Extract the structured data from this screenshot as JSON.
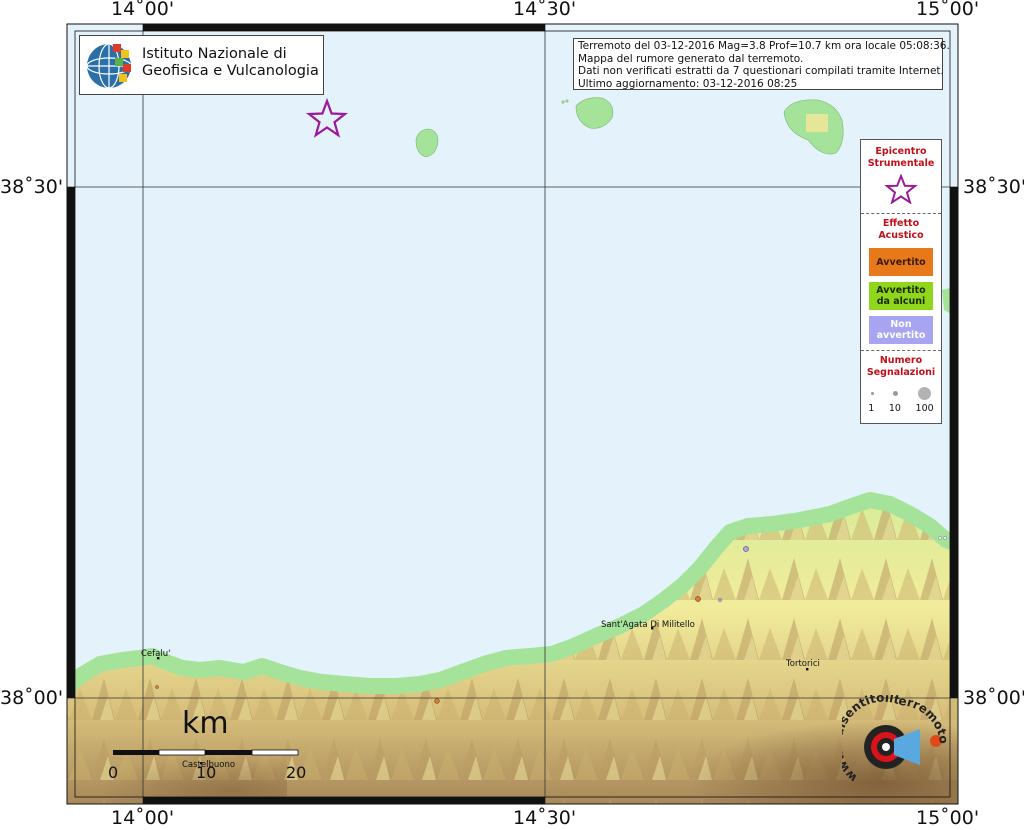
{
  "map": {
    "top_lon_labels": [
      "14˚00'",
      "14˚30'",
      "15˚00'"
    ],
    "bottom_lon_labels": [
      "14˚00'",
      "14˚30'",
      "15˚00'"
    ],
    "left_lat_labels": [
      "38˚30'",
      "38˚00'"
    ],
    "right_lat_labels": [
      "38˚30'",
      "38˚00'"
    ],
    "colors": {
      "sea": "#e3f2fb",
      "coast": "#a6e39a",
      "lowland": "#f3ef9a",
      "hills": "#d4bd7a",
      "mountains": "#8f7046"
    }
  },
  "logo": {
    "line1": "Istituto Nazionale di",
    "line2": "Geofisica e Vulcanologia",
    "icon": "ingv-globe-icon"
  },
  "info": {
    "line1": "Terremoto del 03-12-2016 Mag=3.8 Prof=10.7 km ora locale 05:08:36.",
    "line2": "Mappa del rumore generato dal terremoto.",
    "line3": "Dati non verificati estratti da 7 questionari compilati tramite Internet.",
    "line4": "Ultimo aggiornamento: 03-12-2016 08:25"
  },
  "legend": {
    "epicenter_title": "Epicentro Strumentale",
    "effect_title": "Effetto Acustico",
    "felt": "Avvertito",
    "felt_some_1": "Avvertito",
    "felt_some_2": "da alcuni",
    "not_felt_1": "Non",
    "not_felt_2": "avvertito",
    "count_title_1": "Numero",
    "count_title_2": "Segnalazioni",
    "counts": [
      "1",
      "10",
      "100"
    ],
    "colors": {
      "felt": "#e8791a",
      "felt_some": "#8fd61c",
      "not_felt": "#a7a4f2",
      "epicenter": "#9a1a9a"
    }
  },
  "places": {
    "cefalu": "Cefalu'",
    "castelbuono": "Castelbuono",
    "santagata": "Sant'Agata Di Militello",
    "tortorici": "Tortorici"
  },
  "scale": {
    "unit": "km",
    "labels": [
      "0",
      "10",
      "20"
    ]
  },
  "watermark": {
    "text": "www.haisentitoilterremoto.it"
  }
}
